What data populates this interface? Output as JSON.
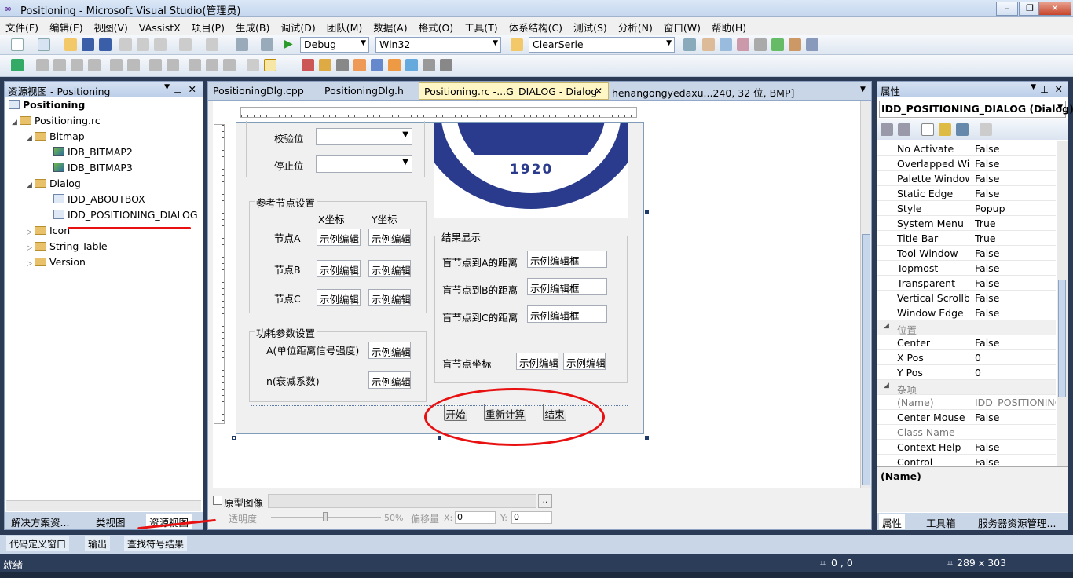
{
  "title": {
    "text": "Positioning - Microsoft Visual Studio(管理员)",
    "logo": "∞"
  },
  "window_controls": {
    "min": "–",
    "max": "❐",
    "close": "✕"
  },
  "menu": [
    "文件(F)",
    "编辑(E)",
    "视图(V)",
    "VAssistX",
    "项目(P)",
    "生成(B)",
    "调试(D)",
    "团队(M)",
    "数据(A)",
    "格式(O)",
    "工具(T)",
    "体系结构(C)",
    "测试(S)",
    "分析(N)",
    "窗口(W)",
    "帮助(H)"
  ],
  "toolbar": {
    "config": "Debug",
    "platform": "Win32",
    "find": "ClearSerie",
    "play": "▶"
  },
  "left_panel": {
    "title": "资源视图 - Positioning",
    "tree": {
      "root": "Positioning",
      "rc": "Positioning.rc",
      "bitmap": "Bitmap",
      "bmp2": "IDB_BITMAP2",
      "bmp3": "IDB_BITMAP3",
      "dialog": "Dialog",
      "about": "IDD_ABOUTBOX",
      "posdlg": "IDD_POSITIONING_DIALOG",
      "icon": "Icon",
      "strtable": "String Table",
      "version": "Version"
    },
    "tabs": [
      "解决方案资...",
      "类视图",
      "资源视图"
    ]
  },
  "doc_tabs": [
    "PositioningDlg.cpp",
    "PositioningDlg.h",
    "Positioning.rc -...G_DIALOG - Dialog",
    "henangongyedaxu...240, 32 位, BMP]"
  ],
  "dialog": {
    "jiaoyan": "校验位",
    "tingzhi": "停止位",
    "ref_group": "参考节点设置",
    "xcoord": "X坐标",
    "ycoord": "Y坐标",
    "nodeA": "节点A",
    "nodeB": "节点B",
    "nodeC": "节点C",
    "edit_sample_short": "示例编辑",
    "power_group": "功耗参数设置",
    "paramA": "A(单位距离信号强度)",
    "paramN": "n(衰减系数)",
    "result_group": "结果显示",
    "distA": "盲节点到A的距离",
    "distB": "盲节点到B的距离",
    "distC": "盲节点到C的距离",
    "edit_sample": "示例编辑框",
    "coord": "盲节点坐标",
    "btn_start": "开始",
    "btn_recalc": "重新计算",
    "btn_end": "结束",
    "logo_year": "1920"
  },
  "editor_bottom": {
    "proto": "原型图像",
    "browse": "..",
    "trans": "透明度",
    "percent": "50%",
    "offset": "偏移量",
    "xlabel": "X:",
    "xval": "0",
    "ylabel": "Y:",
    "yval": "0"
  },
  "props": {
    "title": "属性",
    "selector": "IDD_POSITIONING_DIALOG (Dialog)",
    "rows": [
      {
        "n": "No Activate",
        "v": "False"
      },
      {
        "n": "Overlapped Wi",
        "v": "False"
      },
      {
        "n": "Palette Window",
        "v": "False"
      },
      {
        "n": "Static Edge",
        "v": "False"
      },
      {
        "n": "Style",
        "v": "Popup"
      },
      {
        "n": "System Menu",
        "v": "True"
      },
      {
        "n": "Title Bar",
        "v": "True"
      },
      {
        "n": "Tool Window",
        "v": "False"
      },
      {
        "n": "Topmost",
        "v": "False"
      },
      {
        "n": "Transparent",
        "v": "False"
      },
      {
        "n": "Vertical Scrollb",
        "v": "False"
      },
      {
        "n": "Window Edge",
        "v": "False"
      },
      {
        "n": "位置",
        "v": ""
      },
      {
        "n": "Center",
        "v": "False"
      },
      {
        "n": "X Pos",
        "v": "0"
      },
      {
        "n": "Y Pos",
        "v": "0"
      },
      {
        "n": "杂项",
        "v": ""
      },
      {
        "n": "(Name)",
        "v": "IDD_POSITIONING"
      },
      {
        "n": "Center Mouse",
        "v": "False"
      },
      {
        "n": "Class Name",
        "v": ""
      },
      {
        "n": "Context Help",
        "v": "False"
      },
      {
        "n": "Control",
        "v": "False"
      }
    ],
    "desc": "(Name)",
    "tabs": [
      "属性",
      "工具箱",
      "服务器资源管理..."
    ]
  },
  "output_tabs": [
    "代码定义窗口",
    "输出",
    "查找符号结果"
  ],
  "status": {
    "ready": "就绪",
    "pos": "0 , 0",
    "size": "289 x 303"
  },
  "colors": {
    "accent": "#e81010",
    "statusbar": "#2c3d5a"
  }
}
